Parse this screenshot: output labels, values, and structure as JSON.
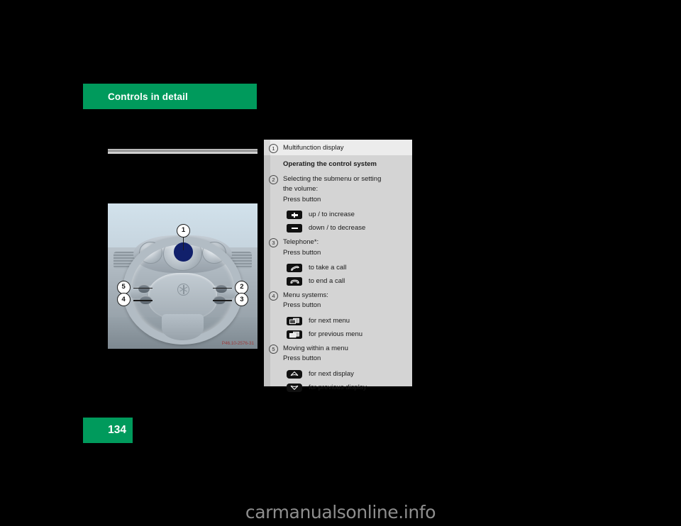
{
  "header": {
    "chapter_title": "Controls in detail"
  },
  "page": {
    "number": "134"
  },
  "figure": {
    "code": "P46.10-2576-31",
    "callouts": [
      {
        "id": "1",
        "label": "1"
      },
      {
        "id": "2",
        "label": "2"
      },
      {
        "id": "3",
        "label": "3"
      },
      {
        "id": "4",
        "label": "4"
      },
      {
        "id": "5",
        "label": "5"
      }
    ]
  },
  "legend": {
    "item1": {
      "num": "1",
      "text": "Multifunction display"
    },
    "heading": "Operating the control system",
    "item2": {
      "num": "2",
      "line1": "Selecting the submenu or setting",
      "line2": "the volume:",
      "line3": "Press button",
      "icons": [
        {
          "icon": "plus-button-icon",
          "label": "up / to increase"
        },
        {
          "icon": "minus-button-icon",
          "label": "down / to decrease"
        }
      ]
    },
    "item3": {
      "num": "3",
      "line1": "Telephone*:",
      "line2": "Press button",
      "icons": [
        {
          "icon": "phone-pickup-icon",
          "label": "to take a call"
        },
        {
          "icon": "phone-hangup-icon",
          "label": "to end a call"
        }
      ]
    },
    "item4": {
      "num": "4",
      "line1": "Menu systems:",
      "line2": "Press button",
      "icons": [
        {
          "icon": "next-menu-icon",
          "label": "for next menu"
        },
        {
          "icon": "previous-menu-icon",
          "label": "for previous menu"
        }
      ]
    },
    "item5": {
      "num": "5",
      "line1": "Moving within a menu",
      "line2": "Press button",
      "icons": [
        {
          "icon": "arrow-up-button-icon",
          "label": "for next display"
        },
        {
          "icon": "arrow-down-button-icon",
          "label": "for previous display"
        }
      ]
    }
  },
  "watermark": {
    "text": "carmanualsonline.info"
  },
  "colors": {
    "brand_green": "#009a5c",
    "panel_grey": "#d4d4d4",
    "icon_black": "#111111",
    "callout_blue": "#11206b"
  }
}
